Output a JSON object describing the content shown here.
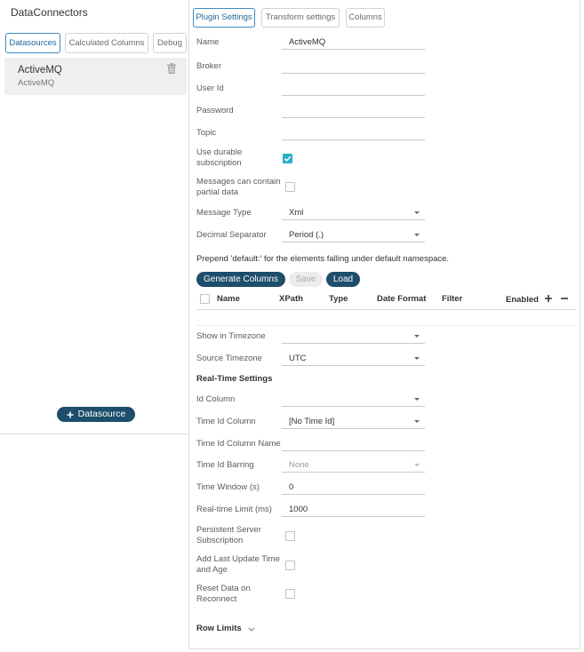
{
  "app": {
    "title": "DataConnectors"
  },
  "colors": {
    "accent": "#3a8cc4",
    "accent_text": "#22679a",
    "primary_button": "#1d4e6b",
    "checkbox_checked": "#2ab0c6",
    "selected_item_bg": "#efefef"
  },
  "left_tabs": [
    {
      "label": "Datasources",
      "active": true
    },
    {
      "label": "Calculated Columns",
      "active": false
    },
    {
      "label": "Debug",
      "active": false
    }
  ],
  "datasources": [
    {
      "name": "ActiveMQ",
      "type": "ActiveMQ",
      "selected": true,
      "action_icon": "trash-icon"
    }
  ],
  "add_datasource_button": {
    "icon": "plus-icon",
    "label": "Datasource"
  },
  "right_tabs": [
    {
      "label": "Plugin Settings",
      "active": true
    },
    {
      "label": "Transform settings",
      "active": false
    },
    {
      "label": "Columns",
      "active": false
    }
  ],
  "plugin_settings": {
    "name": {
      "label": "Name",
      "value": "ActiveMQ"
    },
    "broker": {
      "label": "Broker",
      "value": ""
    },
    "user_id": {
      "label": "User Id",
      "value": ""
    },
    "password": {
      "label": "Password",
      "value": ""
    },
    "topic": {
      "label": "Topic",
      "value": ""
    },
    "use_durable_subscription": {
      "label": "Use durable subscription",
      "checked": true
    },
    "partial_data": {
      "label": "Messages can contain partial data",
      "checked": false
    },
    "message_type": {
      "label": "Message Type",
      "value": "Xml"
    },
    "decimal_separator": {
      "label": "Decimal Separator",
      "value": "Period (.)"
    },
    "namespace_hint": "Prepend 'default:' for the elements falling under default namespace.",
    "actions": [
      {
        "label": "Generate Columns",
        "enabled": true
      },
      {
        "label": "Save",
        "enabled": false
      },
      {
        "label": "Load",
        "enabled": true
      }
    ]
  },
  "columns_table": {
    "select_all_checked": false,
    "headers": [
      "Name",
      "XPath",
      "Type",
      "Date Format",
      "Filter",
      "Enabled"
    ],
    "add_icon": "plus-icon",
    "remove_icon": "minus-icon",
    "rows": []
  },
  "timezone": {
    "show_in_timezone": {
      "label": "Show in Timezone",
      "value": ""
    },
    "source_timezone": {
      "label": "Source Timezone",
      "value": "UTC"
    }
  },
  "real_time_settings": {
    "heading": "Real-Time Settings",
    "id_column": {
      "label": "Id Column",
      "value": ""
    },
    "time_id_column": {
      "label": "Time Id Column",
      "value": "[No Time Id]"
    },
    "time_id_column_name": {
      "label": "Time Id Column Name",
      "value": ""
    },
    "time_id_barring": {
      "label": "Time Id Barring",
      "value": "None",
      "enabled": false
    },
    "time_window": {
      "label": "Time Window (s)",
      "value": "0"
    },
    "real_time_limit": {
      "label": "Real-time Limit (ms)",
      "value": "1000"
    },
    "persistent_server_subscription": {
      "label": "Persistent Server Subscription",
      "checked": false
    },
    "add_last_update_time": {
      "label": "Add Last Update Time and Age",
      "checked": false
    },
    "reset_data_on_reconnect": {
      "label": "Reset Data on Reconnect",
      "checked": false
    }
  },
  "row_limits": {
    "label": "Row Limits",
    "expanded": false,
    "icon": "chevron-down-icon"
  }
}
